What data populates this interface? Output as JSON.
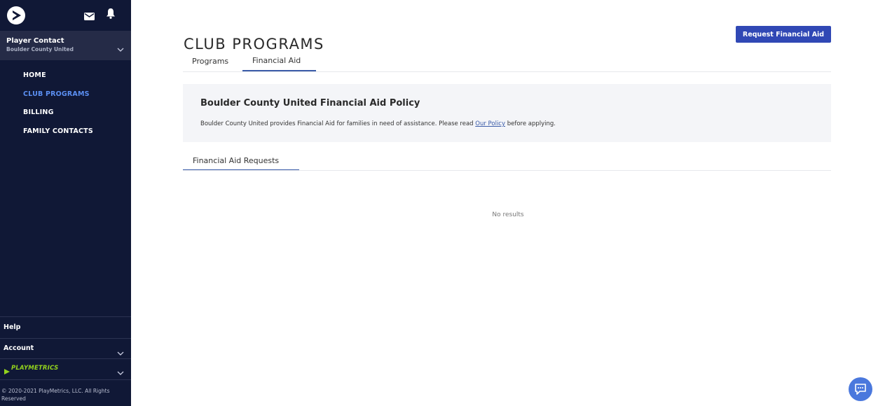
{
  "sidebar": {
    "profile": {
      "name": "Player Contact",
      "club": "Boulder County United"
    },
    "nav": [
      {
        "label": "HOME",
        "active": false
      },
      {
        "label": "CLUB PROGRAMS",
        "active": true
      },
      {
        "label": "BILLING",
        "active": false
      },
      {
        "label": "FAMILY CONTACTS",
        "active": false
      }
    ],
    "help_label": "Help",
    "account_label": "Account",
    "brand_label": "PLAYMETRICS",
    "copyright": "© 2020-2021 PlayMetrics, LLC. All Rights Reserved",
    "icons": {
      "logo": "playmetrics-logo-icon",
      "mail": "envelope-icon",
      "bell": "bell-icon",
      "chat": "chat-icon"
    }
  },
  "header": {
    "title": "CLUB PROGRAMS",
    "request_button": "Request Financial Aid"
  },
  "tabs": [
    {
      "label": "Programs",
      "active": false
    },
    {
      "label": "Financial Aid",
      "active": true
    }
  ],
  "policy": {
    "title": "Boulder County United Financial Aid Policy",
    "text_before": "Boulder County United provides Financial Aid for families in need of assistance. Please read ",
    "link": "Our Policy",
    "text_after": " before applying."
  },
  "requests": {
    "tab_label": "Financial Aid Requests",
    "empty_text": "No results"
  },
  "colors": {
    "sidebar_bg": "#101836",
    "accent": "#3048b5",
    "active_nav": "#5b8ff2",
    "brand_green": "#93d31d"
  }
}
